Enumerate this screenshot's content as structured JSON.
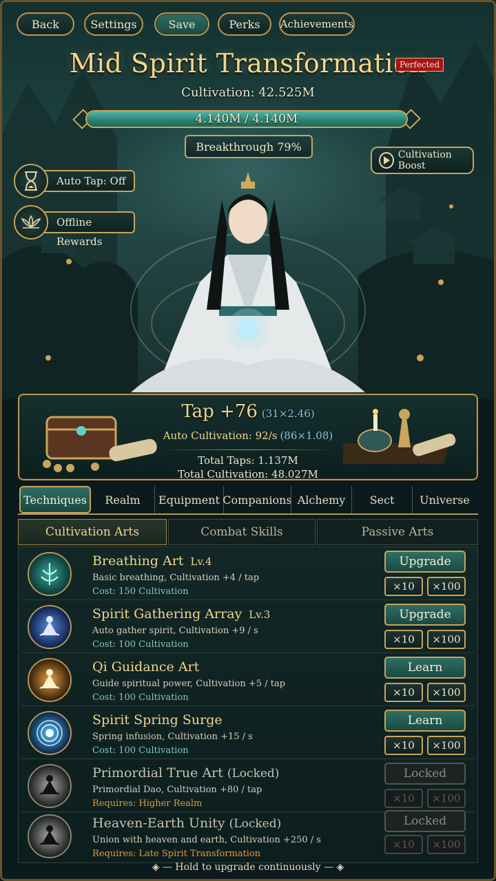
{
  "nav": {
    "back": "Back",
    "settings": "Settings",
    "save": "Save",
    "perks": "Perks",
    "achievements": "Achievements"
  },
  "header": {
    "realm": "Mid Spirit Transformation",
    "badge": "Perfected",
    "cultivation": "Cultivation: 42.525M"
  },
  "progress": {
    "text": "4.140M / 4.140M",
    "fraction": 1.0
  },
  "breakthrough": "Breakthrough 79%",
  "boost": "Cultivation Boost",
  "side": {
    "autotap": "Auto Tap: Off",
    "offline": "Offline Rewards"
  },
  "stats": {
    "tap": "Tap +76",
    "tap_formula": "(31×2.46)",
    "auto": "Auto Cultivation: 92/s",
    "auto_formula": "(86×1.08)",
    "total_taps": "Total Taps: 1.137M",
    "total_cult": "Total Cultivation: 48.027M"
  },
  "tabs": [
    "Techniques",
    "Realm",
    "Equipment",
    "Companions",
    "Alchemy",
    "Sect",
    "Universe"
  ],
  "subtabs": [
    "Cultivation Arts",
    "Combat Skills",
    "Passive Arts"
  ],
  "items": [
    {
      "name": "Breathing Art",
      "level": "Lv.4",
      "desc": "Basic breathing, Cultivation +4 / tap",
      "cost": "Cost: 150 Cultivation",
      "action": "Upgrade",
      "x10": "×10",
      "x100": "×100"
    },
    {
      "name": "Spirit Gathering Array",
      "level": "Lv.3",
      "desc": "Auto gather spirit, Cultivation +9 / s",
      "cost": "Cost: 100 Cultivation",
      "action": "Upgrade",
      "x10": "×10",
      "x100": "×100"
    },
    {
      "name": "Qi Guidance Art",
      "level": "",
      "desc": "Guide spiritual power, Cultivation +5 / tap",
      "cost": "Cost: 100 Cultivation",
      "action": "Learn",
      "x10": "×10",
      "x100": "×100"
    },
    {
      "name": "Spirit Spring Surge",
      "level": "",
      "desc": "Spring infusion, Cultivation +15 / s",
      "cost": "Cost: 100 Cultivation",
      "action": "Learn",
      "x10": "×10",
      "x100": "×100"
    },
    {
      "name": "Primordial True Art",
      "level": "(Locked)",
      "desc": "Primordial Dao, Cultivation +80 / tap",
      "cost": "Requires: Higher Realm",
      "action": "Locked",
      "x10": "×10",
      "x100": "×100"
    },
    {
      "name": "Heaven-Earth Unity",
      "level": "(Locked)",
      "desc": "Union with heaven and earth, Cultivation +250 / s",
      "cost": "Requires: Late Spirit Transformation",
      "action": "Locked",
      "x10": "×10",
      "x100": "×100"
    }
  ],
  "footer": "Hold to upgrade continuously",
  "colors": {
    "gold": "#c9a55e",
    "teal": "#2f6e63",
    "title": "#f3d58d",
    "cost": "#7fc8c0",
    "requires": "#e39a3c"
  }
}
